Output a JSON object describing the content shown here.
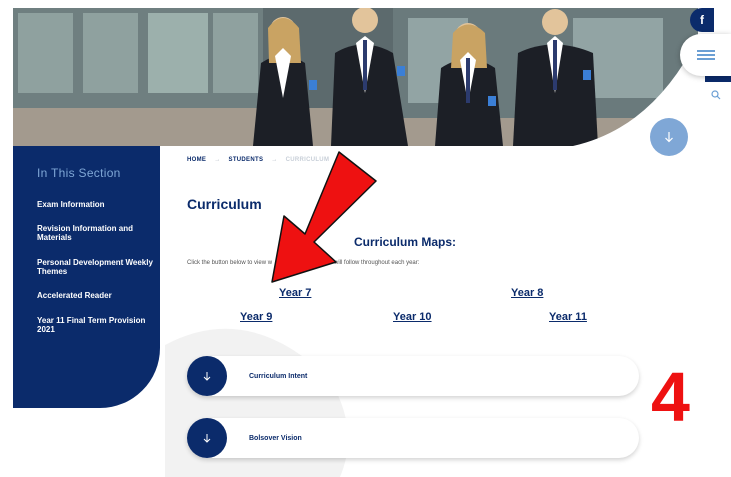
{
  "social": {
    "facebook_label": "f",
    "facebook_icon": "facebook-icon"
  },
  "header": {
    "menu_icon": "hamburger-icon",
    "search_icon": "search-icon",
    "scroll_icon": "arrow-down-icon"
  },
  "sidebar": {
    "title": "In This Section",
    "items": [
      {
        "label": "Exam Information"
      },
      {
        "label": "Revision Information and Materials"
      },
      {
        "label": "Personal Development Weekly Themes"
      },
      {
        "label": "Accelerated Reader"
      },
      {
        "label": "Year 11 Final Term Provision 2021"
      }
    ]
  },
  "breadcrumb": {
    "home": "HOME",
    "sep": "→",
    "students": "STUDENTS",
    "current": "CURRICULUM"
  },
  "main": {
    "title": "Curriculum",
    "maps_title": "Curriculum Maps:",
    "intro_start": "Click the button below to view w",
    "intro_end": "will follow throughout each year:",
    "years": [
      "Year 7",
      "Year 8",
      "Year 9",
      "Year 10",
      "Year 11"
    ]
  },
  "accordions": [
    {
      "label": "Curriculum Intent",
      "icon": "arrow-down-icon"
    },
    {
      "label": "Bolsover Vision",
      "icon": "arrow-down-icon"
    }
  ],
  "annotation": {
    "number": "4",
    "color": "#ee1111"
  },
  "colors": {
    "navy": "#0b2b6b",
    "light_blue": "#7fa7d6"
  }
}
